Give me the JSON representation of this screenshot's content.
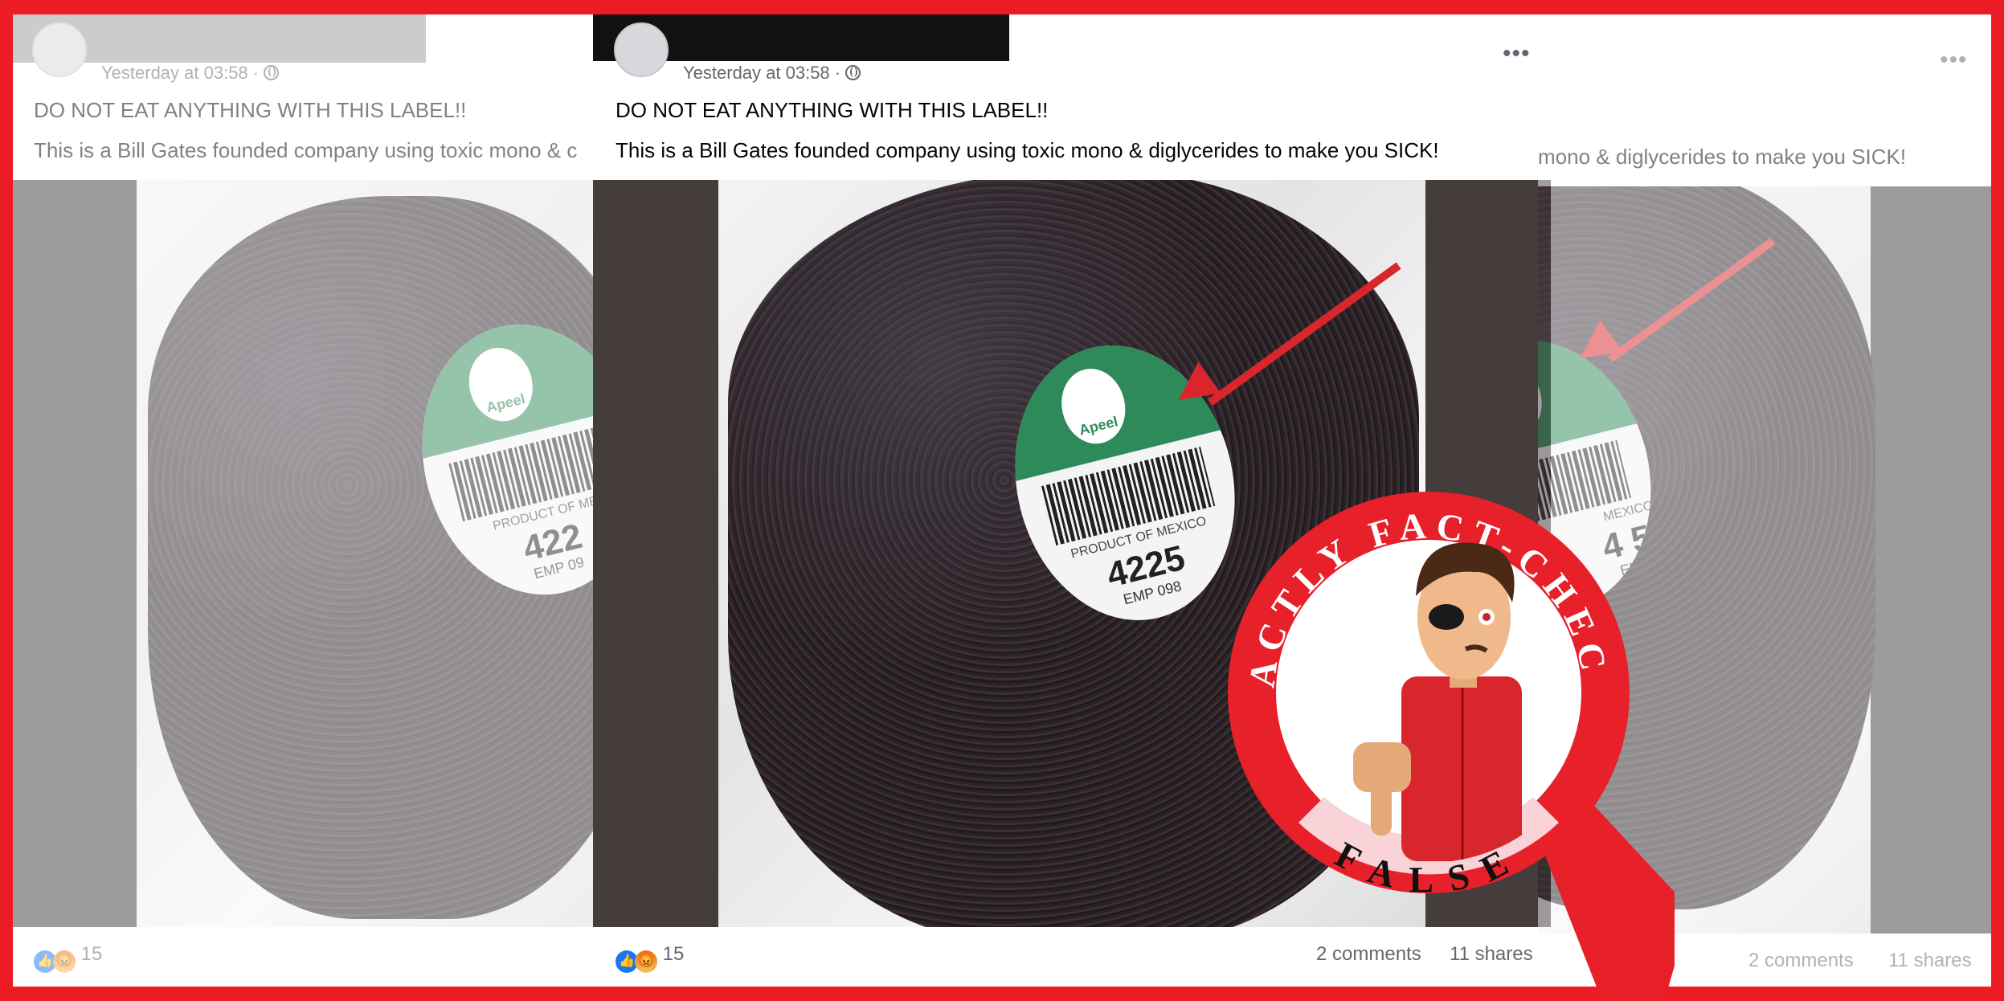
{
  "post": {
    "timestamp": "Yesterday at 03:58 ·",
    "headline": "DO NOT EAT ANYTHING WITH THIS LABEL!!",
    "body": "This is a Bill Gates founded company using toxic mono & diglycerides to make you SICK!",
    "body_left_crop": "This is a Bill Gates founded company using toxic mono & c",
    "body_right_crop": "mono & diglycerides to make you SICK!",
    "more_options": "•••",
    "reaction_count": "15",
    "comments": "2 comments",
    "shares": "11 shares",
    "comments_right_crop": "2 comments"
  },
  "sticker": {
    "brand": "Apeel",
    "origin": "PRODUCT OF MEXICO",
    "origin_left_crop": "PRODUCT OF ME",
    "origin_right_crop": "MEXICO",
    "plu": "4225",
    "plu_left_crop": "422",
    "plu_right_crop": "4  5",
    "emp": "EMP 098",
    "emp_left_crop": "EMP 09",
    "emp_right_crop": "EM"
  },
  "stamp": {
    "ring_text": "FACTLY FACT-CHECK",
    "verdict": "FALSE"
  },
  "colors": {
    "border_red": "#ec1c24",
    "stamp_red": "#e8202a",
    "verdict_pink": "#f9d3d8",
    "facebook_blue": "#1877f2"
  },
  "icons": [
    "globe-icon",
    "more-options-icon",
    "like-reaction-icon",
    "angry-reaction-icon",
    "pointer-arrow-icon"
  ]
}
